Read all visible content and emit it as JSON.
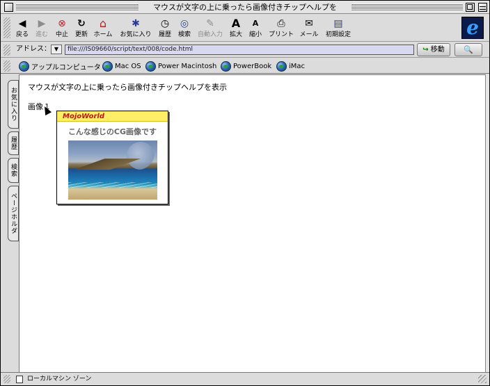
{
  "window": {
    "title": "マウスが文字の上に乗ったら画像付きチップヘルプを"
  },
  "toolbar": {
    "buttons": [
      {
        "label": "戻る",
        "icon": "back-arrow-icon",
        "glyph": "◀",
        "enabled": true
      },
      {
        "label": "進む",
        "icon": "forward-arrow-icon",
        "glyph": "▶",
        "enabled": false
      },
      {
        "label": "中止",
        "icon": "stop-icon",
        "glyph": "⊗",
        "enabled": true
      },
      {
        "label": "更新",
        "icon": "refresh-icon",
        "glyph": "↻",
        "enabled": true
      },
      {
        "label": "ホーム",
        "icon": "home-icon",
        "glyph": "⌂",
        "enabled": true
      },
      {
        "label": "お気に入り",
        "icon": "favorites-icon",
        "glyph": "✱",
        "enabled": true
      },
      {
        "label": "履歴",
        "icon": "history-icon",
        "glyph": "◷",
        "enabled": true
      },
      {
        "label": "検索",
        "icon": "search-icon",
        "glyph": "◎",
        "enabled": true
      },
      {
        "label": "自動入力",
        "icon": "autofill-icon",
        "glyph": "✎",
        "enabled": false
      },
      {
        "label": "拡大",
        "icon": "text-larger-icon",
        "glyph": "A",
        "enabled": true
      },
      {
        "label": "縮小",
        "icon": "text-smaller-icon",
        "glyph": "A",
        "enabled": true
      },
      {
        "label": "プリント",
        "icon": "print-icon",
        "glyph": "⎙",
        "enabled": true
      },
      {
        "label": "メール",
        "icon": "mail-icon",
        "glyph": "✉",
        "enabled": true
      },
      {
        "label": "初期設定",
        "icon": "preferences-icon",
        "glyph": "▤",
        "enabled": true
      }
    ],
    "logo": "e"
  },
  "address": {
    "label": "アドレス：",
    "url": "file:///IS09660/script/text/008/code.html",
    "go_label": "移動",
    "search_glyph": "🔍"
  },
  "favorites": {
    "items": [
      "アップルコンピュータ",
      "Mac OS",
      "Power Macintosh",
      "PowerBook",
      "iMac"
    ]
  },
  "sidetabs": [
    "お気に入り",
    "履歴",
    "検索",
    "ページホルダ"
  ],
  "page": {
    "heading": "マウスが文字の上に乗ったら画像付きチップヘルプを表示",
    "link_text": "画像１",
    "tooltip": {
      "brand": "MojoWorld",
      "caption": "こんな感じのCG画像です"
    }
  },
  "status": {
    "zone": "ローカルマシン ゾーン"
  }
}
